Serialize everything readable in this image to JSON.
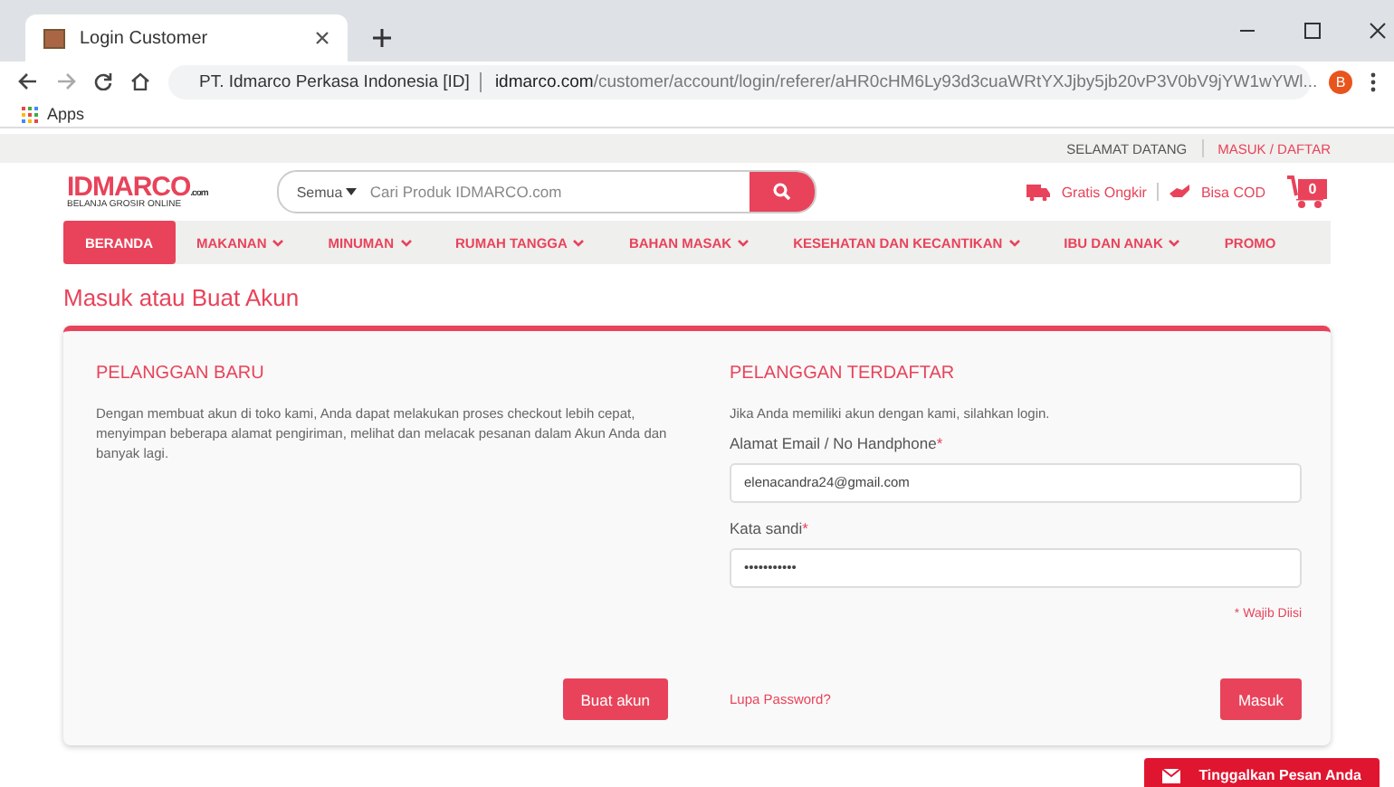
{
  "browser": {
    "tab_title": "Login Customer",
    "site_name": "PT. Idmarco Perkasa Indonesia [ID]",
    "url_domain": "idmarco.com",
    "url_path": "/customer/account/login/referer/aHR0cHM6Ly93d3cuaWRtYXJjby5jb20vP3V0bV9jYW1wYWl...",
    "profile_initial": "B",
    "bookmarks": [
      "Apps"
    ]
  },
  "top_bar": {
    "greeting": "SELAMAT DATANG",
    "login_link": "MASUK / DAFTAR"
  },
  "header": {
    "logo": "IDMARCO",
    "logo_suffix": ".com",
    "tagline": "BELANJA GROSIR ONLINE",
    "search": {
      "category": "Semua",
      "placeholder": "Cari Produk IDMARCO.com"
    },
    "perks": [
      "Gratis Ongkir",
      "Bisa COD"
    ],
    "cart_count": "0"
  },
  "nav": [
    {
      "label": "BERANDA",
      "selected": true,
      "has_menu": false
    },
    {
      "label": "MAKANAN",
      "selected": false,
      "has_menu": true
    },
    {
      "label": "MINUMAN",
      "selected": false,
      "has_menu": true
    },
    {
      "label": "RUMAH TANGGA",
      "selected": false,
      "has_menu": true
    },
    {
      "label": "BAHAN MASAK",
      "selected": false,
      "has_menu": true
    },
    {
      "label": "KESEHATAN DAN KECANTIKAN",
      "selected": false,
      "has_menu": true
    },
    {
      "label": "IBU DAN ANAK",
      "selected": false,
      "has_menu": true
    },
    {
      "label": "PROMO",
      "selected": false,
      "has_menu": false
    }
  ],
  "page_title": "Masuk atau Buat Akun",
  "new_customer": {
    "heading": "PELANGGAN BARU",
    "text": "Dengan membuat akun di toko kami, Anda dapat melakukan proses checkout lebih cepat, menyimpan beberapa alamat pengiriman, melihat dan melacak pesanan dalam Akun Anda dan banyak lagi.",
    "button": "Buat akun"
  },
  "registered_customer": {
    "heading": "PELANGGAN TERDAFTAR",
    "intro": "Jika Anda memiliki akun dengan kami, silahkan login.",
    "fields": [
      {
        "label": "Alamat Email / No Handphone",
        "required_mark": "*",
        "value": "elenacandra24@gmail.com"
      },
      {
        "label": "Kata sandi",
        "required_mark": "*",
        "value": "•••••••••••"
      }
    ],
    "required_note": "* Wajib Diisi",
    "forgot_link": "Lupa Password?",
    "button": "Masuk"
  },
  "chat_widget": {
    "label": "Tinggalkan Pesan Anda"
  }
}
